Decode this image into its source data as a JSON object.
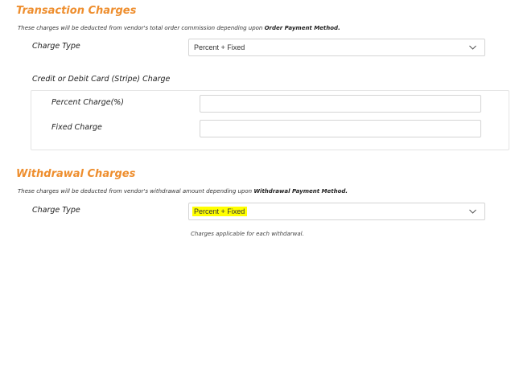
{
  "transaction": {
    "title": "Transaction Charges",
    "desc_prefix": "These charges will be deducted from vendor's total order commission depending upon ",
    "desc_bold": "Order Payment Method.",
    "charge_type_label": "Charge Type",
    "charge_type_value": "Percent + Fixed",
    "stripe_heading": "Credit or Debit Card (Stripe) Charge",
    "percent_label": "Percent Charge(%)",
    "percent_value": "",
    "fixed_label": "Fixed Charge",
    "fixed_value": ""
  },
  "withdrawal": {
    "title": "Withdrawal Charges",
    "desc_prefix": "These charges will be deducted from vendor's withdrawal amount depending upon ",
    "desc_bold": "Withdrawal Payment Method.",
    "charge_type_label": "Charge Type",
    "charge_type_value": "Percent + Fixed",
    "help_text": "Charges applicable for each withdarwal."
  },
  "icons": {
    "dropdown": "chevron-down-icon"
  },
  "colors": {
    "section_title": "#ee8e2e",
    "highlight": "#ffff00"
  }
}
